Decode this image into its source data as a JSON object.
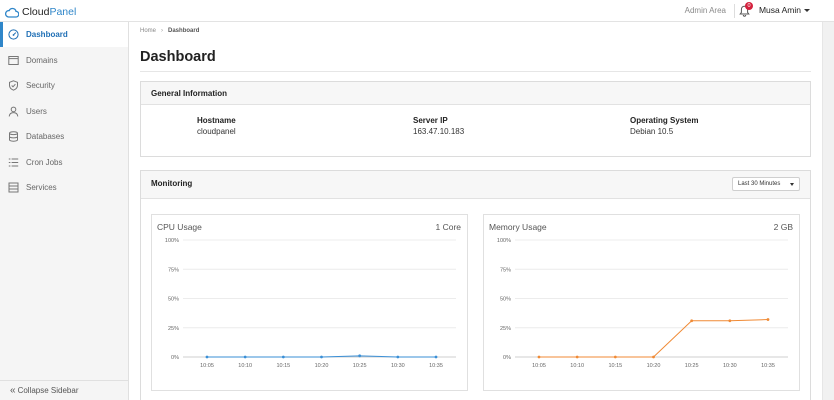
{
  "app": {
    "logo_part1": "Cloud",
    "logo_part2": "Panel",
    "admin_area": "Admin Area",
    "notification_count": "0",
    "user_name": "Musa Amin"
  },
  "sidebar": {
    "items": [
      {
        "label": "Dashboard",
        "icon": "dashboard-icon",
        "active": true
      },
      {
        "label": "Domains",
        "icon": "browser-window-icon",
        "active": false
      },
      {
        "label": "Security",
        "icon": "shield-icon",
        "active": false
      },
      {
        "label": "Users",
        "icon": "user-icon",
        "active": false
      },
      {
        "label": "Databases",
        "icon": "database-icon",
        "active": false
      },
      {
        "label": "Cron Jobs",
        "icon": "list-icon",
        "active": false
      },
      {
        "label": "Services",
        "icon": "server-icon",
        "active": false
      }
    ],
    "collapse_label": "Collapse Sidebar"
  },
  "breadcrumb": {
    "home": "Home",
    "current": "Dashboard"
  },
  "page_title": "Dashboard",
  "general_info": {
    "title": "General Information",
    "fields": [
      {
        "label": "Hostname",
        "value": "cloudpanel"
      },
      {
        "label": "Server IP",
        "value": "163.47.10.183"
      },
      {
        "label": "Operating System",
        "value": "Debian 10.5"
      }
    ]
  },
  "monitoring": {
    "title": "Monitoring",
    "range_selected": "Last 30 Minutes"
  },
  "colors": {
    "accent": "#2f86c9",
    "cpu_series": "#3a8fd6",
    "memory_series": "#f08a35",
    "badge": "#d4213d"
  },
  "chart_data": [
    {
      "type": "line",
      "title": "CPU Usage",
      "meta": "1 Core",
      "x": [
        "10:05",
        "10:10",
        "10:15",
        "10:20",
        "10:25",
        "10:30",
        "10:35"
      ],
      "y_ticks": [
        "100%",
        "75%",
        "50%",
        "25%",
        "0%"
      ],
      "ylim": [
        0,
        100
      ],
      "series": [
        {
          "values": [
            0,
            0,
            0,
            0,
            1,
            0,
            0
          ]
        }
      ],
      "grid": true
    },
    {
      "type": "line",
      "title": "Memory Usage",
      "meta": "2 GB",
      "x": [
        "10:05",
        "10:10",
        "10:15",
        "10:20",
        "10:25",
        "10:30",
        "10:35"
      ],
      "y_ticks": [
        "100%",
        "75%",
        "50%",
        "25%",
        "0%"
      ],
      "ylim": [
        0,
        100
      ],
      "series": [
        {
          "values": [
            0,
            0,
            0,
            0,
            31,
            31,
            32
          ]
        }
      ],
      "grid": true
    }
  ]
}
